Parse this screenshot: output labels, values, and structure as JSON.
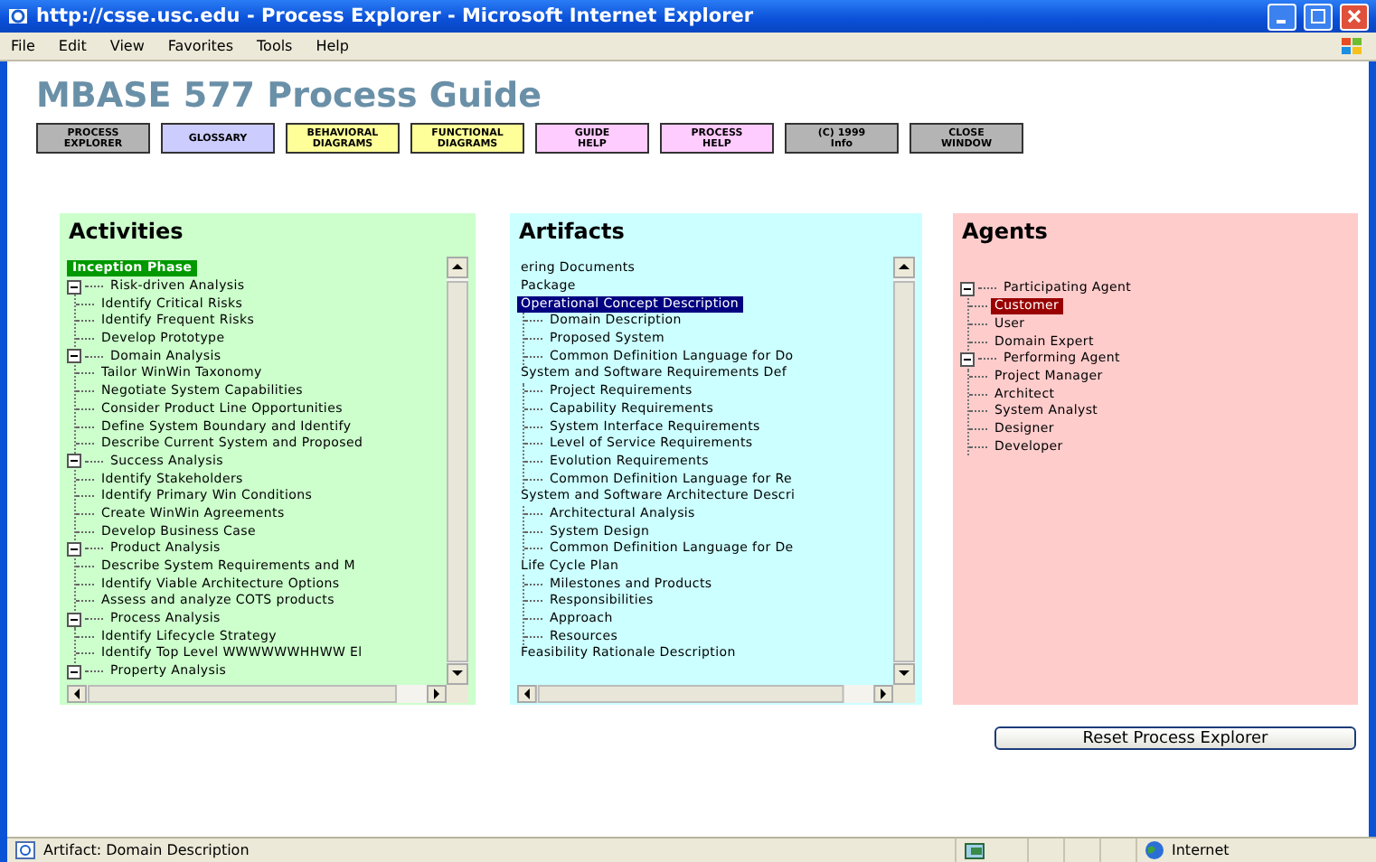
{
  "window": {
    "title": "http://csse.usc.edu - Process Explorer - Microsoft Internet Explorer"
  },
  "menu": [
    "File",
    "Edit",
    "View",
    "Favorites",
    "Tools",
    "Help"
  ],
  "heading": "MBASE 577 Process Guide",
  "buttons": [
    {
      "label": "PROCESS\nEXPLORER",
      "color": "#b4b4b4"
    },
    {
      "label": "GLOSSARY",
      "color": "#ccccff"
    },
    {
      "label": "BEHAVIORAL\nDIAGRAMS",
      "color": "#ffff99"
    },
    {
      "label": "FUNCTIONAL\nDIAGRAMS",
      "color": "#ffff99"
    },
    {
      "label": "GUIDE\nHELP",
      "color": "#ffccff"
    },
    {
      "label": "PROCESS\nHELP",
      "color": "#ffccff"
    },
    {
      "label": "(C) 1999\nInfo",
      "color": "#b4b4b4"
    },
    {
      "label": "CLOSE\nWINDOW",
      "color": "#b4b4b4"
    }
  ],
  "panels": [
    {
      "title": "Activities",
      "color": "#ccffcc",
      "scrollbars": true,
      "phase": {
        "label": "Inception Phase",
        "selected": true
      },
      "items": [
        {
          "label": "Risk-driven Analysis",
          "expanded": true,
          "selected": false,
          "children": [
            {
              "label": "Identify Critical Risks",
              "selected": false
            },
            {
              "label": "Identify Frequent Risks",
              "selected": false
            },
            {
              "label": "Develop Prototype",
              "selected": false
            }
          ]
        },
        {
          "label": "Domain Analysis",
          "expanded": true,
          "selected": false,
          "children": [
            {
              "label": "Tailor WinWin Taxonomy",
              "selected": false
            },
            {
              "label": "Negotiate System Capabilities",
              "selected": false
            },
            {
              "label": "Consider Product Line Opportunities",
              "selected": false
            },
            {
              "label": "Define System Boundary and Identify",
              "selected": false
            },
            {
              "label": "Describe Current System and Proposed",
              "selected": false
            }
          ]
        },
        {
          "label": "Success Analysis",
          "expanded": true,
          "selected": false,
          "children": [
            {
              "label": "Identify Stakeholders",
              "selected": false
            },
            {
              "label": "Identify Primary Win Conditions",
              "selected": false
            },
            {
              "label": "Create WinWin Agreements",
              "selected": false
            },
            {
              "label": "Develop Business Case",
              "selected": false
            }
          ]
        },
        {
          "label": "Product Analysis",
          "expanded": true,
          "selected": false,
          "children": [
            {
              "label": "Describe System Requirements and M",
              "selected": false
            },
            {
              "label": "Identify Viable Architecture Options",
              "selected": false
            },
            {
              "label": "Assess and analyze COTS products",
              "selected": false
            }
          ]
        },
        {
          "label": "Process Analysis",
          "expanded": true,
          "selected": false,
          "children": [
            {
              "label": "Identify Lifecycle Strategy",
              "selected": false
            },
            {
              "label": "Identify Top Level WWWWWWHHWW El",
              "selected": false
            }
          ]
        },
        {
          "label": "Property Analysis",
          "expanded": true,
          "selected": false
        }
      ]
    },
    {
      "title": "Artifacts",
      "color": "#ccffff",
      "scrollbars": true,
      "items": [
        {
          "label": "ering Documents",
          "selected": false
        },
        {
          "label": "Package",
          "selected": false
        },
        {
          "label": "Operational Concept Description",
          "selected": true,
          "children": [
            {
              "label": "Domain Description",
              "selected": false
            },
            {
              "label": "Proposed System",
              "selected": false
            },
            {
              "label": "Common Definition Language for Do",
              "selected": false
            }
          ]
        },
        {
          "label": "System and Software Requirements Def",
          "selected": false,
          "children": [
            {
              "label": "Project Requirements",
              "selected": false
            },
            {
              "label": "Capability Requirements",
              "selected": false
            },
            {
              "label": "System Interface Requirements",
              "selected": false
            },
            {
              "label": "Level of Service Requirements",
              "selected": false
            },
            {
              "label": "Evolution Requirements",
              "selected": false
            },
            {
              "label": "Common Definition Language for Re",
              "selected": false
            }
          ]
        },
        {
          "label": "System and Software Architecture Descri",
          "selected": false,
          "children": [
            {
              "label": "Architectural Analysis",
              "selected": false
            },
            {
              "label": "System Design",
              "selected": false
            },
            {
              "label": "Common Definition Language for De",
              "selected": false
            }
          ]
        },
        {
          "label": "Life Cycle Plan",
          "selected": false,
          "children": [
            {
              "label": "Milestones and Products",
              "selected": false
            },
            {
              "label": "Responsibilities",
              "selected": false
            },
            {
              "label": "Approach",
              "selected": false
            },
            {
              "label": "Resources",
              "selected": false
            }
          ]
        },
        {
          "label": "Feasibility Rationale Description",
          "selected": false
        }
      ]
    },
    {
      "title": "Agents",
      "color": "#ffcccc",
      "scrollbars": false,
      "items": [
        {
          "label": "Participating Agent",
          "expanded": true,
          "selected": false,
          "children": [
            {
              "label": "Customer",
              "selected": true
            },
            {
              "label": "User",
              "selected": false
            },
            {
              "label": "Domain Expert",
              "selected": false
            }
          ]
        },
        {
          "label": "Performing Agent",
          "expanded": true,
          "selected": false,
          "children": [
            {
              "label": "Project Manager",
              "selected": false
            },
            {
              "label": "Architect",
              "selected": false
            },
            {
              "label": "System Analyst",
              "selected": false
            },
            {
              "label": "Designer",
              "selected": false
            },
            {
              "label": "Developer",
              "selected": false
            }
          ]
        }
      ]
    }
  ],
  "reset_button": "Reset Process Explorer",
  "status_bar": {
    "text": "Artifact: Domain Description",
    "zone": "Internet"
  }
}
